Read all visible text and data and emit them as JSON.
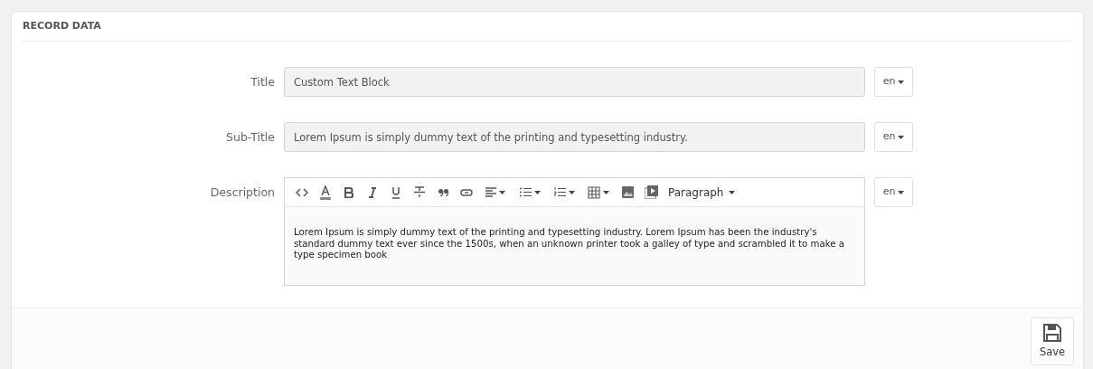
{
  "panel": {
    "title": "RECORD DATA"
  },
  "fields": [
    {
      "kind": "text",
      "label": "Title",
      "value": "Custom Text Block",
      "language": "en"
    },
    {
      "kind": "text",
      "label": "Sub-Title",
      "value": "Lorem Ipsum is simply dummy text of the printing and typesetting industry.",
      "language": "en"
    },
    {
      "kind": "editor",
      "label": "Description",
      "format": "Paragraph",
      "value": "Lorem Ipsum is simply dummy text of the printing and typesetting industry. Lorem Ipsum has been the industry's standard dummy text ever since the 1500s, when an unknown printer took a galley of type and scrambled it to make a type specimen book",
      "language": "en"
    }
  ],
  "footer": {
    "save_label": "Save"
  }
}
